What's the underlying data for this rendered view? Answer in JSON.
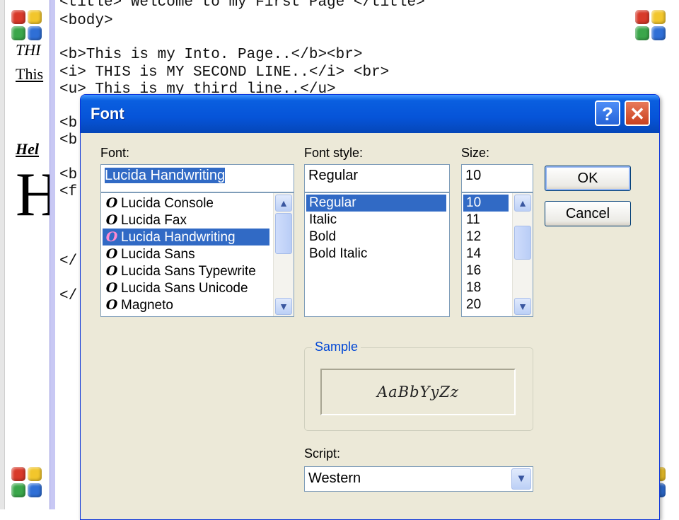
{
  "editor": {
    "lines": [
      "<title> Welcome to my First Page </title>",
      "<body>",
      "<b>This is my Into. Page..</b><br>",
      "<i> THIS is MY SECOND LINE..</i> <br>",
      "<u> This is my third line..</u>"
    ],
    "fragments": [
      "<b",
      "<b",
      "<b",
      "<f",
      "</",
      "</"
    ]
  },
  "preview": {
    "italic_text": "THI",
    "underline_text": "This",
    "bolditalic_text": "Hel",
    "big_text": "H"
  },
  "dialog": {
    "title": "Font",
    "help_label": "?",
    "close_label": "✕",
    "font_label": "Font:",
    "font_value": "Lucida Handwriting",
    "style_label": "Font style:",
    "style_value": "Regular",
    "size_label": "Size:",
    "size_value": "10",
    "ok_label": "OK",
    "cancel_label": "Cancel",
    "sample_label": "Sample",
    "sample_text": "AaBbYyZz",
    "script_label": "Script:",
    "script_value": "Western",
    "fonts": [
      {
        "name": "Lucida Console",
        "selected": false
      },
      {
        "name": "Lucida Fax",
        "selected": false
      },
      {
        "name": "Lucida Handwriting",
        "selected": true
      },
      {
        "name": "Lucida Sans",
        "selected": false
      },
      {
        "name": "Lucida Sans Typewrite",
        "selected": false
      },
      {
        "name": "Lucida Sans Unicode",
        "selected": false
      },
      {
        "name": "Magneto",
        "selected": false
      }
    ],
    "styles": [
      {
        "name": "Regular",
        "selected": true
      },
      {
        "name": "Italic",
        "selected": false
      },
      {
        "name": "Bold",
        "selected": false
      },
      {
        "name": "Bold Italic",
        "selected": false
      }
    ],
    "sizes": [
      {
        "name": "10",
        "selected": true
      },
      {
        "name": "11",
        "selected": false
      },
      {
        "name": "12",
        "selected": false
      },
      {
        "name": "14",
        "selected": false
      },
      {
        "name": "16",
        "selected": false
      },
      {
        "name": "18",
        "selected": false
      },
      {
        "name": "20",
        "selected": false
      }
    ],
    "font_icon_glyph": "O",
    "scroll_up_glyph": "▲",
    "scroll_down_glyph": "▼"
  },
  "colors": {
    "selection": "#316ac5",
    "titlebar": "#0654d8",
    "dialog_bg": "#ece9d8"
  }
}
